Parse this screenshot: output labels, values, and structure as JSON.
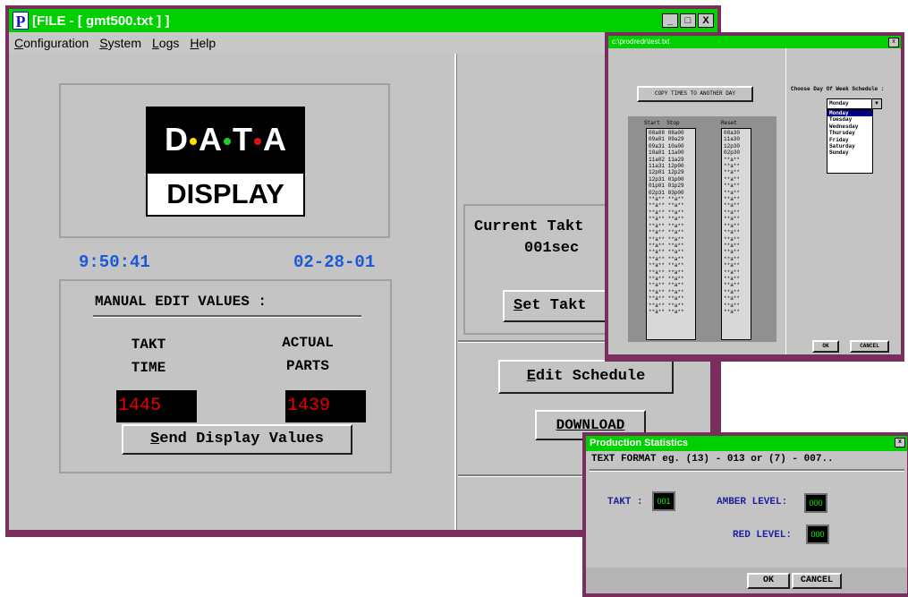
{
  "main_window": {
    "title": "[FILE - [ gmt500.txt ] ]",
    "app_icon": "P",
    "buttons": {
      "minimize": "_",
      "maximize": "□",
      "close": "X"
    },
    "menu": [
      {
        "label_u": "C",
        "label_rest": "onfiguration"
      },
      {
        "label_u": "S",
        "label_rest": "ystem"
      },
      {
        "label_u": "L",
        "label_rest": "ogs"
      },
      {
        "label_u": "H",
        "label_rest": "elp"
      }
    ]
  },
  "logo": {
    "letters": [
      "D",
      "A",
      "T",
      "A"
    ],
    "dot_colors": [
      "#ffe000",
      "#20d020",
      "#e01010"
    ],
    "bottom": "DISPLAY"
  },
  "clock": {
    "time": "9:50:41",
    "date": "02-28-01"
  },
  "manual_edit": {
    "title": "MANUAL EDIT VALUES  :",
    "takt_label_1": "TAKT",
    "takt_label_2": "TIME",
    "actual_label_1": "ACTUAL",
    "actual_label_2": "PARTS",
    "takt_value": "1445",
    "actual_value": "1439",
    "send_button_u": "S",
    "send_button_rest": "end Display Values"
  },
  "takt_panel": {
    "title": "Current Takt",
    "value": "001sec",
    "button_u": "S",
    "button_rest": "et Takt"
  },
  "right_buttons": {
    "edit_u": "E",
    "edit_rest": "dit Schedule",
    "download": "DOWNLOAD"
  },
  "schedule_dialog": {
    "title": "c:\\prodredr\\test.txt",
    "copy_button": "COPY TIMES TO ANOTHER DAY",
    "choose_label": "Choose Day Of Week Schedule :",
    "selected_day": "Monday",
    "days": [
      "Monday",
      "Tuesday",
      "Wednesday",
      "Thursday",
      "Friday",
      "Saturday",
      "Sunday"
    ],
    "header_start_stop": "Start  Stop",
    "header_reset": "Reset",
    "start_stop_rows": [
      "08a08 08a00",
      "09a01 09a29",
      "09a31 10a00",
      "10a01 11a00",
      "11a02 11a29",
      "11a31 12p00",
      "12p01 12p29",
      "12p31 01p00",
      "01p01 01p29",
      "02p31 03p00",
      "**a** **a**",
      "**a** **a**",
      "**a** **a**",
      "**a** **a**",
      "**a** **a**",
      "**a** **a**",
      "**a** **a**",
      "**a** **a**",
      "**a** **a**",
      "**a** **a**",
      "**a** **a**",
      "**a** **a**",
      "**a** **a**",
      "**a** **a**",
      "**a** **a**",
      "**a** **a**",
      "**a** **a**",
      "**a** **a**"
    ],
    "reset_rows": [
      "08a30",
      "11a30",
      "12p30",
      "02p30",
      "**a**",
      "**a**",
      "**a**",
      "**a**",
      "**a**",
      "**a**",
      "**a**",
      "**a**",
      "**a**",
      "**a**",
      "**a**",
      "**a**",
      "**a**",
      "**a**",
      "**a**",
      "**a**",
      "**a**",
      "**a**",
      "**a**",
      "**a**",
      "**a**",
      "**a**",
      "**a**",
      "**a**"
    ],
    "ok": "OK",
    "cancel": "CANCEL"
  },
  "production_dialog": {
    "title": "Production Statistics",
    "format_text": "TEXT FORMAT eg. (13) - 013 or (7) - 007..",
    "takt_label": "TAKT :",
    "amber_label": "AMBER LEVEL:",
    "red_label": "RED LEVEL:",
    "takt_value": "001",
    "amber_value": "000",
    "red_value": "000",
    "ok": "OK",
    "cancel": "CANCEL"
  }
}
